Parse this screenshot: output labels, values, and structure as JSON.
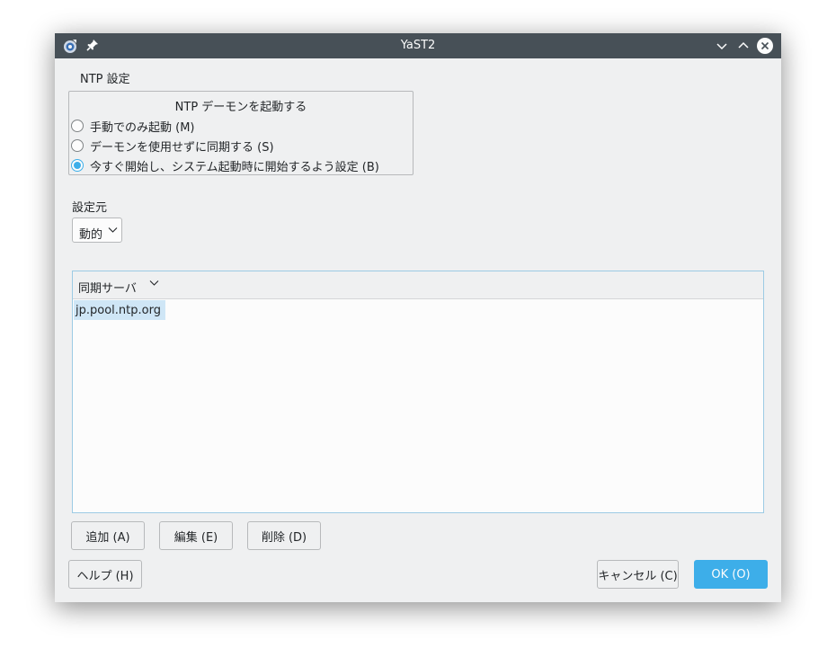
{
  "window": {
    "title": "YaST2"
  },
  "section_title": "NTP 設定",
  "daemon_group": {
    "title": "NTP デーモンを起動する",
    "options": [
      {
        "label": "手動でのみ起動 (M)",
        "selected": false
      },
      {
        "label": "デーモンを使用せずに同期する (S)",
        "selected": false
      },
      {
        "label": "今すぐ開始し、システム起動時に開始するよう設定 (B)",
        "selected": true
      }
    ]
  },
  "config_source": {
    "label": "設定元",
    "value": "動的"
  },
  "servers": {
    "column_header": "同期サーバ",
    "items": [
      "jp.pool.ntp.org"
    ]
  },
  "buttons": {
    "add": "追加 (A)",
    "edit": "編集 (E)",
    "delete": "削除 (D)",
    "help": "ヘルプ (H)",
    "cancel": "キャンセル (C)",
    "ok": "OK (O)"
  },
  "colors": {
    "accent": "#3daee9",
    "titlebar": "#475057",
    "selection": "#cfe6f6"
  }
}
